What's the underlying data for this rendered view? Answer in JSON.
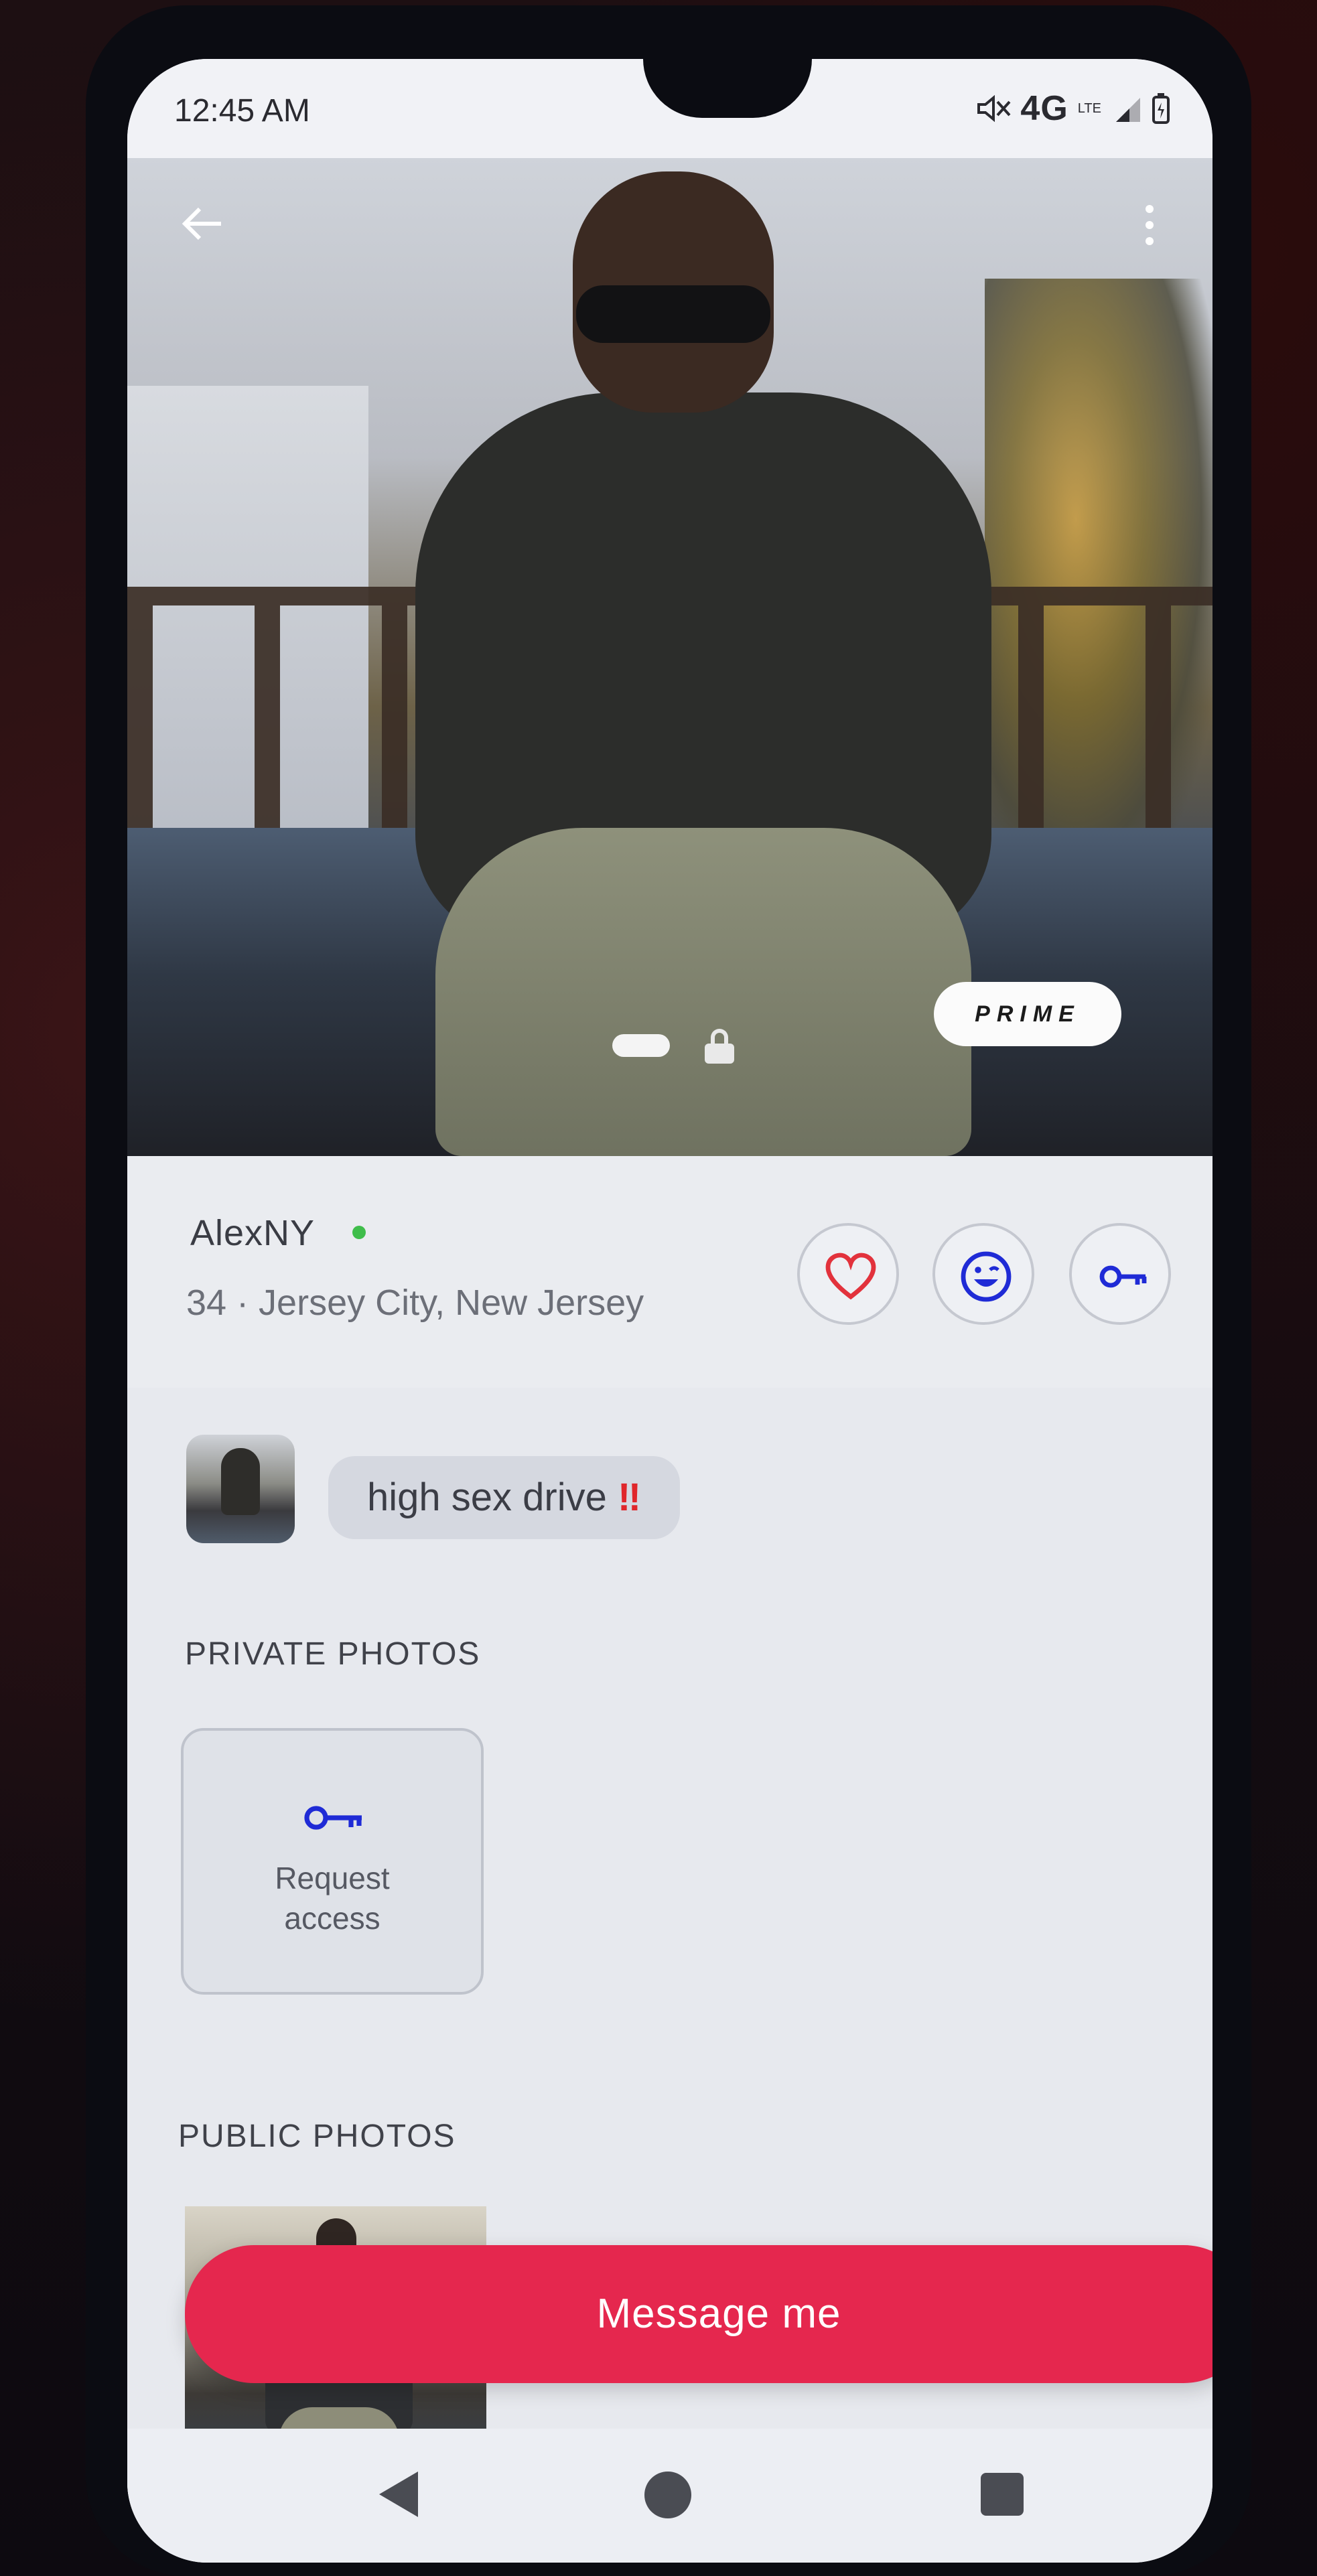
{
  "status_bar": {
    "time": "12:45 AM",
    "network": "4G",
    "network_sub": "LTE"
  },
  "hero": {
    "badge": "PRIME",
    "icons": [
      "back-arrow-icon",
      "more-vert-icon",
      "lock-icon"
    ]
  },
  "profile": {
    "name": "AlexNY",
    "online": true,
    "subtitle": "34 · Jersey City, New Jersey",
    "actions": [
      "heart-icon",
      "wink-icon",
      "key-icon"
    ],
    "colors": {
      "heart": "#e2323c",
      "wink": "#1f2bd6",
      "key": "#1f2bd6",
      "online": "#3fbd4b"
    }
  },
  "bio": {
    "text": "high sex drive",
    "emoji": "‼"
  },
  "sections": {
    "private_title": "PRIVATE PHOTOS",
    "request_label": "Request access",
    "public_title": "PUBLIC PHOTOS"
  },
  "cta": {
    "label": "Message me",
    "color": "#e5274e"
  },
  "nav": [
    "back-triangle-icon",
    "home-circle-icon",
    "recents-square-icon"
  ]
}
